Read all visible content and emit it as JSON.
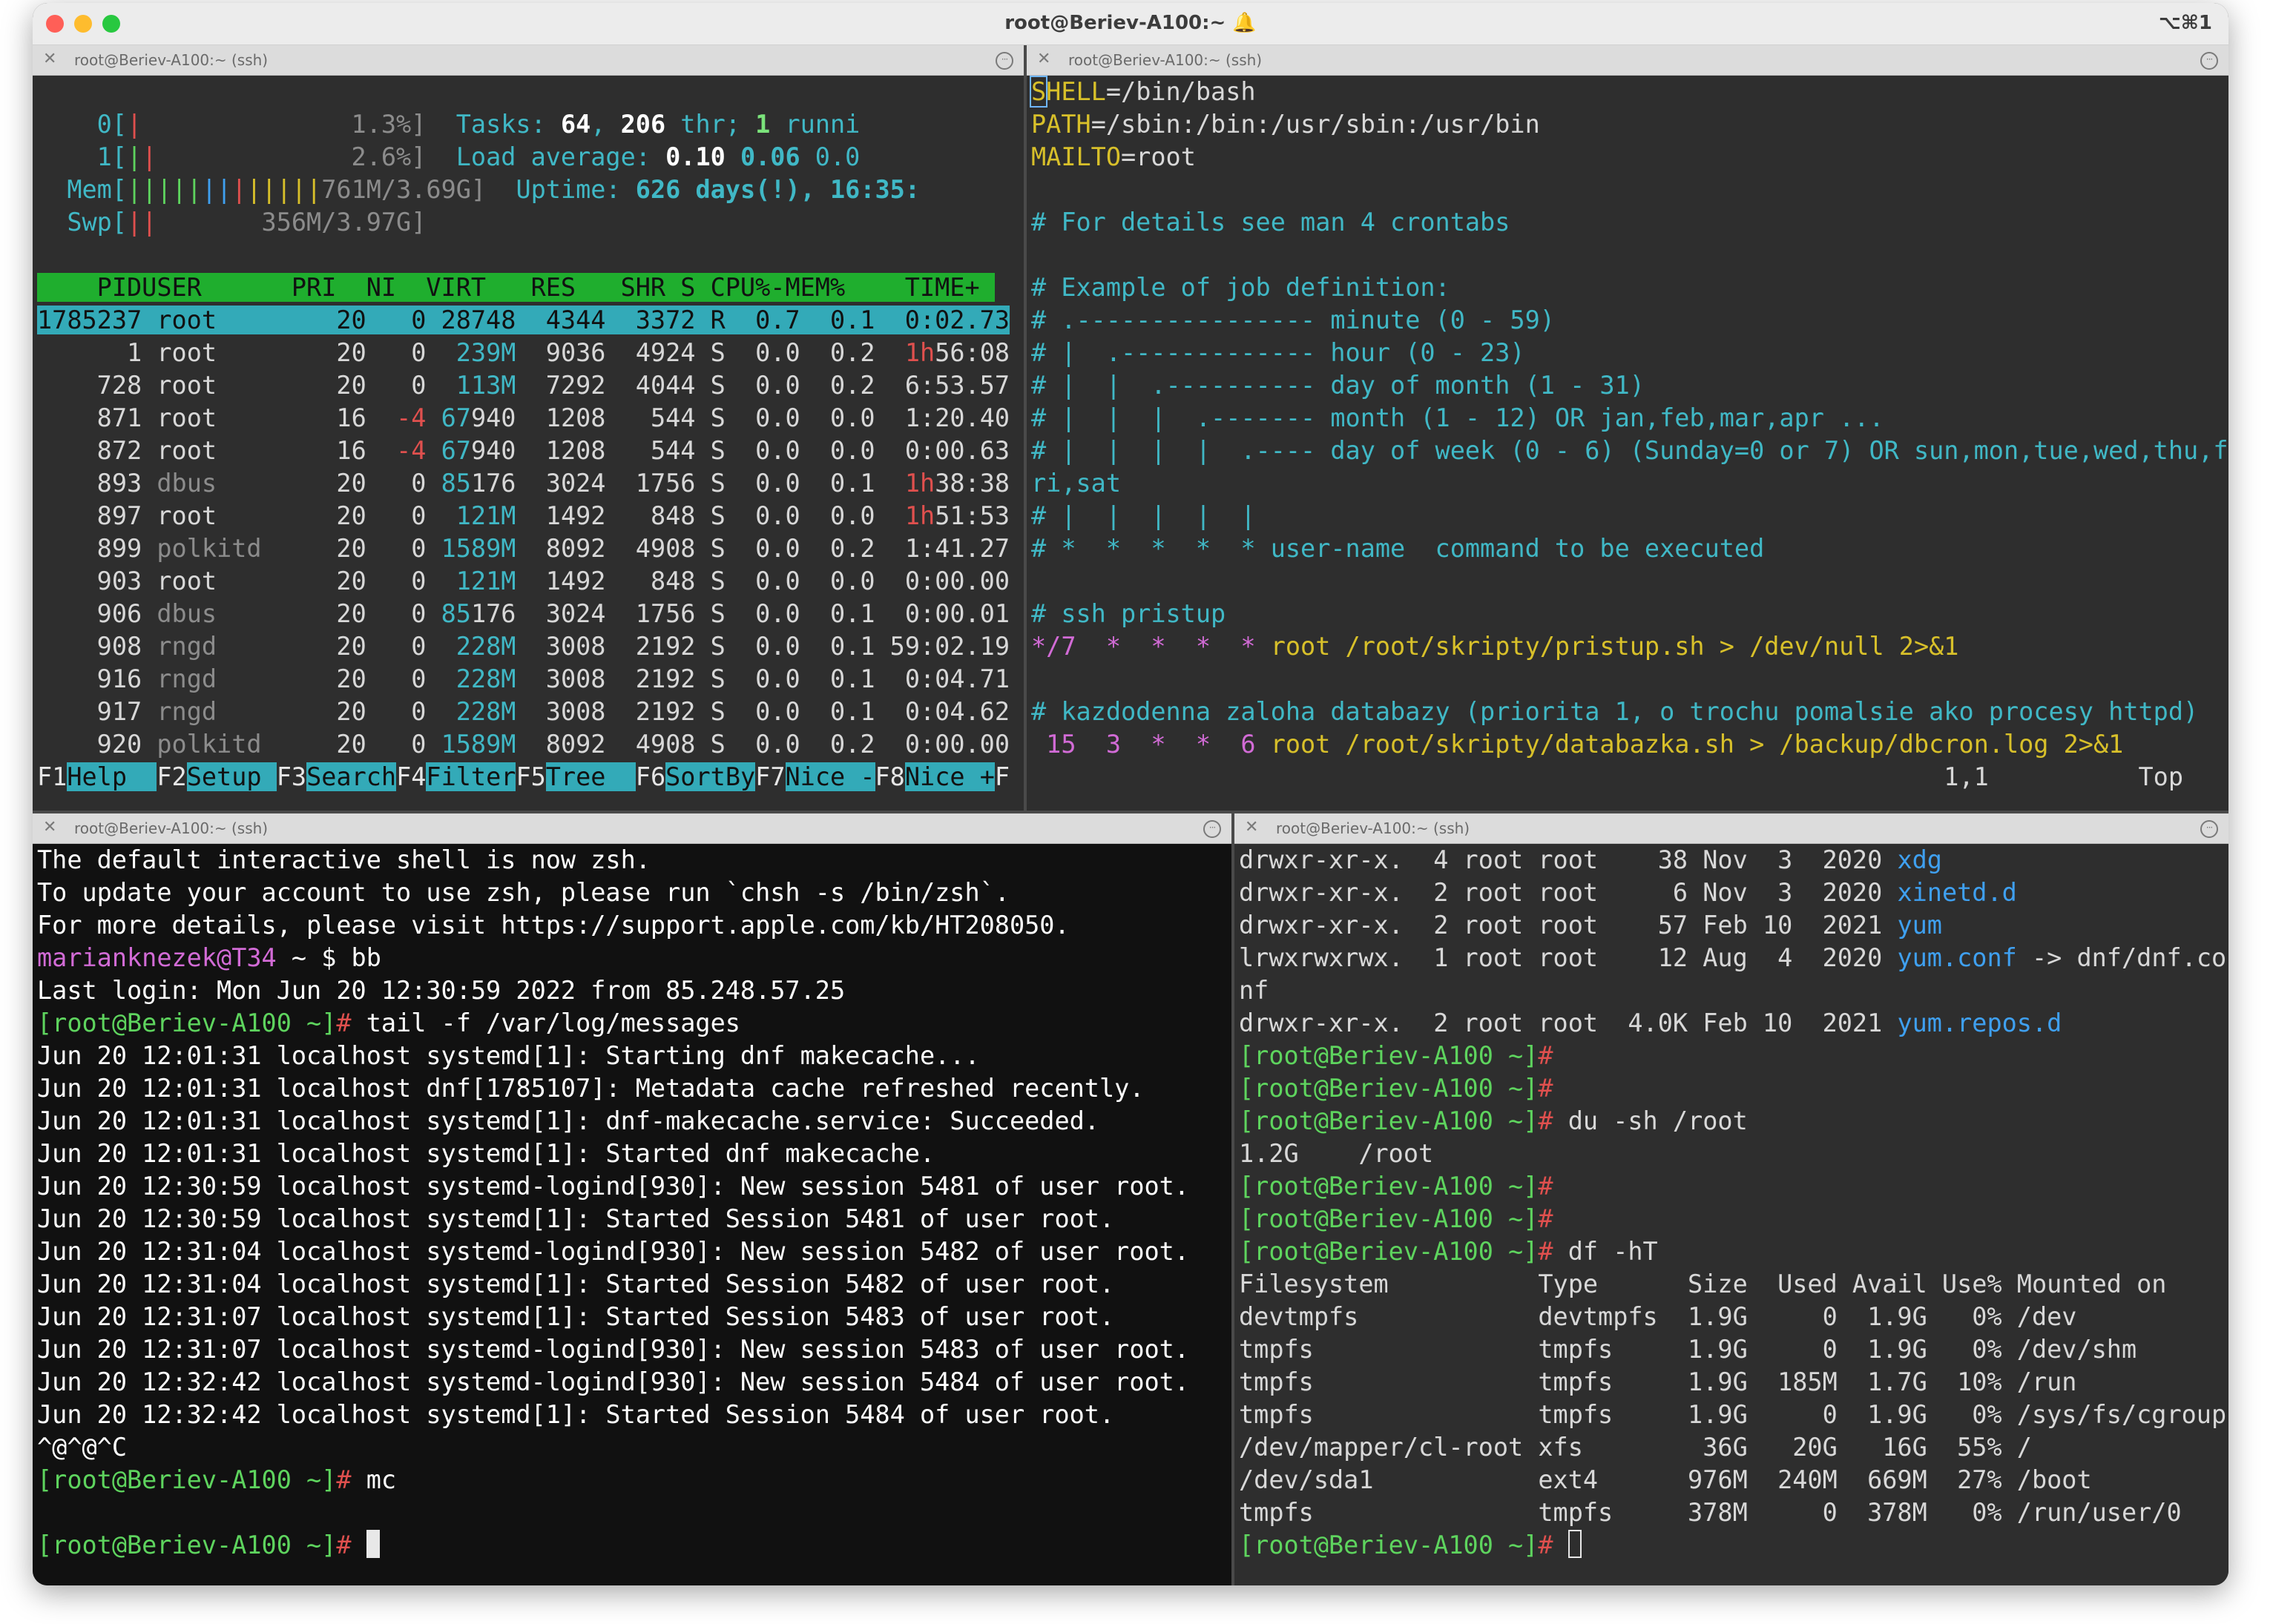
{
  "window": {
    "title": "root@Beriev-A100:~",
    "title_icon": "bell-icon",
    "shortcut": "⌥⌘1"
  },
  "panes": {
    "top_left": {
      "tab_title": "root@Beriev-A100:~ (ssh)",
      "close": "✕",
      "menu": "···"
    },
    "top_right": {
      "tab_title": "root@Beriev-A100:~ (ssh)",
      "close": "✕",
      "menu": "···"
    },
    "bottom_left": {
      "tab_title": "root@Beriev-A100:~ (ssh)",
      "close": "✕",
      "menu": "···"
    },
    "bottom_right": {
      "tab_title": "root@Beriev-A100:~ (ssh)",
      "close": "✕",
      "menu": "···"
    }
  },
  "htop": {
    "meters": [
      {
        "label": "0[",
        "bar": "|",
        "value": "1.3%]"
      },
      {
        "label": "1[",
        "bar": "||",
        "value": "2.6%]"
      },
      {
        "label": "Mem[",
        "bar": "|||||||||||||",
        "value": "761M/3.69G]"
      },
      {
        "label": "Swp[",
        "bar": "||",
        "value": "356M/3.97G]"
      }
    ],
    "tasks_label": "Tasks: ",
    "tasks_value": "64, 206 thr; 1 runni",
    "load_label": "Load average: ",
    "load_value": "0.10 0.06 0.0",
    "uptime_label": "Uptime: ",
    "uptime_value": "626 days(!), 16:35:",
    "header": [
      "    PID",
      "USER     ",
      " PRI",
      "  NI",
      "  VIRT",
      "   RES",
      "   SHR",
      " S",
      "CPU%",
      "-MEM%",
      "   TIME+ "
    ],
    "rows": [
      [
        "1785237",
        "root     ",
        "20",
        " 0",
        "28748",
        "4344",
        "3372",
        "R",
        "0.7",
        "0.1",
        " 0:02.73"
      ],
      [
        "      1",
        "root     ",
        "20",
        " 0",
        " 239M",
        "9036",
        "4924",
        "S",
        "0.0",
        "0.2",
        " 1h56:08"
      ],
      [
        "    728",
        "root     ",
        "20",
        " 0",
        " 113M",
        "7292",
        "4044",
        "S",
        "0.0",
        "0.2",
        " 6:53.57"
      ],
      [
        "    871",
        "root     ",
        "16",
        "-4",
        "67940",
        "1208",
        " 544",
        "S",
        "0.0",
        "0.0",
        " 1:20.40"
      ],
      [
        "    872",
        "root     ",
        "16",
        "-4",
        "67940",
        "1208",
        " 544",
        "S",
        "0.0",
        "0.0",
        " 0:00.63"
      ],
      [
        "    893",
        "dbus     ",
        "20",
        " 0",
        "85176",
        "3024",
        "1756",
        "S",
        "0.0",
        "0.1",
        " 1h38:38"
      ],
      [
        "    897",
        "root     ",
        "20",
        " 0",
        " 121M",
        "1492",
        " 848",
        "S",
        "0.0",
        "0.0",
        " 1h51:53"
      ],
      [
        "    899",
        "polkitd  ",
        "20",
        " 0",
        "1589M",
        "8092",
        "4908",
        "S",
        "0.0",
        "0.2",
        " 1:41.27"
      ],
      [
        "    903",
        "root     ",
        "20",
        " 0",
        " 121M",
        "1492",
        " 848",
        "S",
        "0.0",
        "0.0",
        " 0:00.00"
      ],
      [
        "    906",
        "dbus     ",
        "20",
        " 0",
        "85176",
        "3024",
        "1756",
        "S",
        "0.0",
        "0.1",
        " 0:00.01"
      ],
      [
        "    908",
        "rngd     ",
        "20",
        " 0",
        " 228M",
        "3008",
        "2192",
        "S",
        "0.0",
        "0.1",
        "59:02.19"
      ],
      [
        "    916",
        "rngd     ",
        "20",
        " 0",
        " 228M",
        "3008",
        "2192",
        "S",
        "0.0",
        "0.1",
        " 0:04.71"
      ],
      [
        "    917",
        "rngd     ",
        "20",
        " 0",
        " 228M",
        "3008",
        "2192",
        "S",
        "0.0",
        "0.1",
        " 0:04.62"
      ],
      [
        "    920",
        "polkitd  ",
        "20",
        " 0",
        "1589M",
        "8092",
        "4908",
        "S",
        "0.0",
        "0.2",
        " 0:00.00"
      ]
    ],
    "fkeys": [
      {
        "key": "F1",
        "label": "Help  "
      },
      {
        "key": "F2",
        "label": "Setup "
      },
      {
        "key": "F3",
        "label": "Search"
      },
      {
        "key": "F4",
        "label": "Filter"
      },
      {
        "key": "F5",
        "label": "Tree  "
      },
      {
        "key": "F6",
        "label": "SortBy"
      },
      {
        "key": "F7",
        "label": "Nice -"
      },
      {
        "key": "F8",
        "label": "Nice +"
      },
      {
        "key": "F",
        "label": ""
      }
    ]
  },
  "crontab": {
    "lines": [
      "SHELL=/bin/bash",
      "PATH=/sbin:/bin:/usr/sbin:/usr/bin",
      "MAILTO=root",
      "",
      "# For details see man 4 crontabs",
      "",
      "# Example of job definition:",
      "# .---------------- minute (0 - 59)",
      "# |  .------------- hour (0 - 23)",
      "# |  |  .---------- day of month (1 - 31)",
      "# |  |  |  .------- month (1 - 12) OR jan,feb,mar,apr ...",
      "# |  |  |  |  .---- day of week (0 - 6) (Sunday=0 or 7) OR sun,mon,tue,wed,thu,f",
      "ri,sat",
      "# |  |  |  |  |",
      "# *  *  *  *  * user-name  command to be executed",
      "",
      "# ssh pristup",
      "*/7  *  *  *  * root /root/skripty/pristup.sh > /dev/null 2>&1",
      "",
      "# kazdodenna zaloha databazy (priorita 1, o trochu pomalsie ako procesy httpd)",
      " 15  3  *  *  6 root /root/skripty/databazka.sh > /backup/dbcron.log 2>&1"
    ],
    "status_pos": "1,1",
    "status_where": "Top"
  },
  "terminal_left": {
    "lines": [
      "The default interactive shell is now zsh.",
      "To update your account to use zsh, please run `chsh -s /bin/zsh`.",
      "For more details, please visit https://support.apple.com/kb/HT208050."
    ],
    "local_prompt": "marianknezek@T34 ~ $ ",
    "local_cmd": "bb",
    "last_login": "Last login: Mon Jun 20 12:30:59 2022 from 85.248.57.25",
    "prompt": "[root@Beriev-A100 ~]",
    "hash": "# ",
    "cmd1": "tail -f /var/log/messages",
    "log": [
      "Jun 20 12:01:31 localhost systemd[1]: Starting dnf makecache...",
      "Jun 20 12:01:31 localhost dnf[1785107]: Metadata cache refreshed recently.",
      "Jun 20 12:01:31 localhost systemd[1]: dnf-makecache.service: Succeeded.",
      "Jun 20 12:01:31 localhost systemd[1]: Started dnf makecache.",
      "Jun 20 12:30:59 localhost systemd-logind[930]: New session 5481 of user root.",
      "Jun 20 12:30:59 localhost systemd[1]: Started Session 5481 of user root.",
      "Jun 20 12:31:04 localhost systemd-logind[930]: New session 5482 of user root.",
      "Jun 20 12:31:04 localhost systemd[1]: Started Session 5482 of user root.",
      "Jun 20 12:31:07 localhost systemd[1]: Started Session 5483 of user root.",
      "Jun 20 12:31:07 localhost systemd-logind[930]: New session 5483 of user root.",
      "Jun 20 12:32:42 localhost systemd-logind[930]: New session 5484 of user root.",
      "Jun 20 12:32:42 localhost systemd[1]: Started Session 5484 of user root."
    ],
    "ctrl": "^@^@^C",
    "cmd2": "mc"
  },
  "terminal_right": {
    "ls": [
      {
        "perm": "drwxr-xr-x.",
        "links": " 4",
        "owner": "root root",
        "size": "   38",
        "month": "Nov",
        "day": " 3",
        "year": " 2020",
        "name": "xdg",
        "rest": ""
      },
      {
        "perm": "drwxr-xr-x.",
        "links": " 2",
        "owner": "root root",
        "size": "    6",
        "month": "Nov",
        "day": " 3",
        "year": " 2020",
        "name": "xinetd.d",
        "rest": ""
      },
      {
        "perm": "drwxr-xr-x.",
        "links": " 2",
        "owner": "root root",
        "size": "   57",
        "month": "Feb",
        "day": "10",
        "year": " 2021",
        "name": "yum",
        "rest": ""
      },
      {
        "perm": "lrwxrwxrwx.",
        "links": " 1",
        "owner": "root root",
        "size": "   12",
        "month": "Aug",
        "day": " 4",
        "year": " 2020",
        "name": "yum.conf",
        "rest": " -> dnf/dnf.co"
      }
    ],
    "wrap": "nf",
    "ls_last": {
      "perm": "drwxr-xr-x.",
      "links": " 2",
      "owner": "root root",
      "size": " 4.0K",
      "month": "Feb",
      "day": "10",
      "year": " 2021",
      "name": "yum.repos.d",
      "rest": ""
    },
    "prompt": "[root@Beriev-A100 ~]",
    "hash": "# ",
    "cmd_du": "du -sh /root",
    "du_out": "1.2G    /root",
    "cmd_df": "df -hT",
    "df_header": "Filesystem          Type      Size  Used Avail Use% Mounted on",
    "df_rows": [
      "devtmpfs            devtmpfs  1.9G     0  1.9G   0% /dev",
      "tmpfs               tmpfs     1.9G     0  1.9G   0% /dev/shm",
      "tmpfs               tmpfs     1.9G  185M  1.7G  10% /run",
      "tmpfs               tmpfs     1.9G     0  1.9G   0% /sys/fs/cgroup",
      "/dev/mapper/cl-root xfs        36G   20G   16G  55% /",
      "/dev/sda1           ext4      976M  240M  669M  27% /boot",
      "tmpfs               tmpfs     378M     0  378M   0% /run/user/0"
    ]
  },
  "colors": {
    "green": "#5ed45e",
    "cyan": "#40b8c6",
    "red": "#e0504e",
    "blue": "#3fa0f0",
    "magenta": "#d26bd6",
    "htop_header_bg": "#1fae2e",
    "htop_select_bg": "#33aab8"
  }
}
